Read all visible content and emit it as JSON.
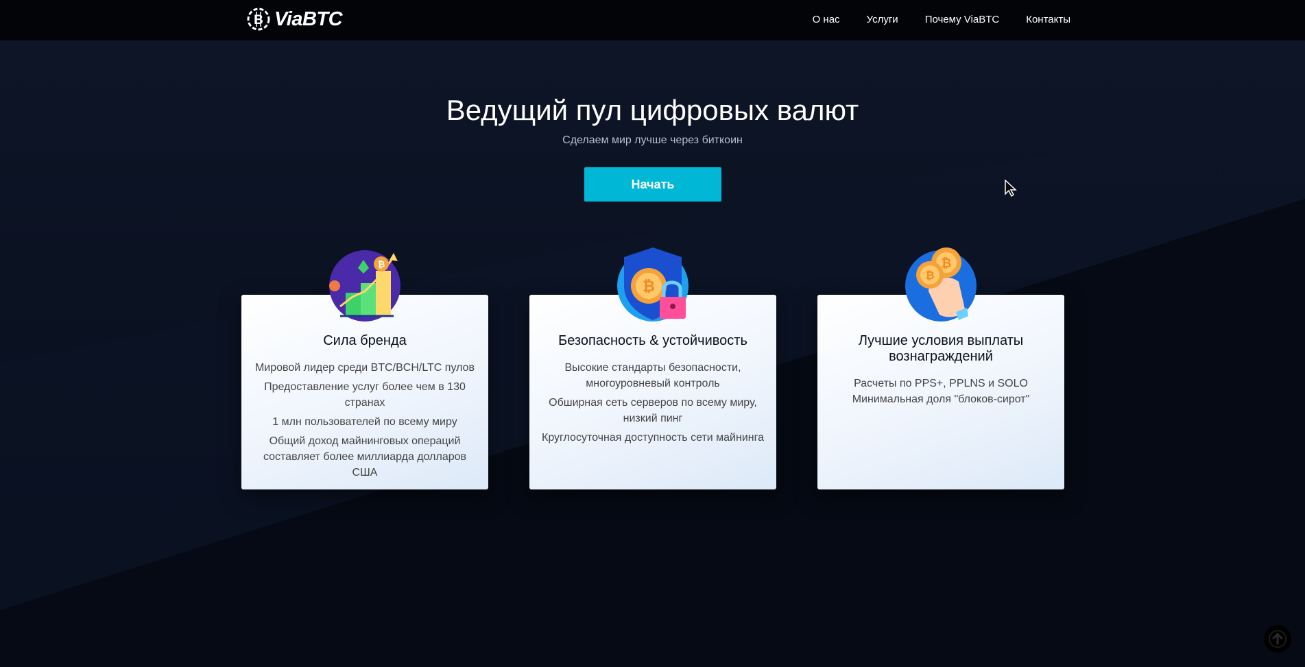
{
  "brand": {
    "logo_text": "ViaBTC",
    "logo_icon": "bitcoin-gear-icon"
  },
  "nav": {
    "items": [
      {
        "label": "О нас"
      },
      {
        "label": "Услуги"
      },
      {
        "label": "Почему ViaBTC"
      },
      {
        "label": "Контакты"
      }
    ]
  },
  "hero": {
    "title": "Ведущий пул цифровых валют",
    "subtitle": "Сделаем мир лучше через биткоин",
    "cta_label": "Начать"
  },
  "cards": [
    {
      "icon": "growth-chart-icon",
      "title": "Сила бренда",
      "lines": [
        "Мировой лидер среди BTC/BCH/LTC пулов",
        "Предоставление услуг более чем в 130 странах",
        "1 млн пользователей по всему миру",
        "Общий доход майнинговых операций составляет более миллиарда долларов США"
      ]
    },
    {
      "icon": "shield-lock-icon",
      "title": "Безопасность & устойчивость",
      "lines": [
        "Высокие стандарты безопасности, многоуровневый контроль",
        "Обширная сеть серверов по всему миру, низкий пинг",
        "Круглосуточная доступность сети майнинга"
      ]
    },
    {
      "icon": "coins-hand-icon",
      "title": "Лучшие условия выплаты вознаграждений",
      "lines": [
        "Расчеты по PPS+, PPLNS и SOLO",
        "Минимальная доля \"блоков-сирот\""
      ]
    }
  ],
  "colors": {
    "accent": "#00b7d6",
    "background": "#0b1222",
    "navbar": "#020407"
  },
  "misc": {
    "back_to_top_icon": "arrow-up-icon",
    "cursor_icon": "mouse-cursor-icon"
  }
}
